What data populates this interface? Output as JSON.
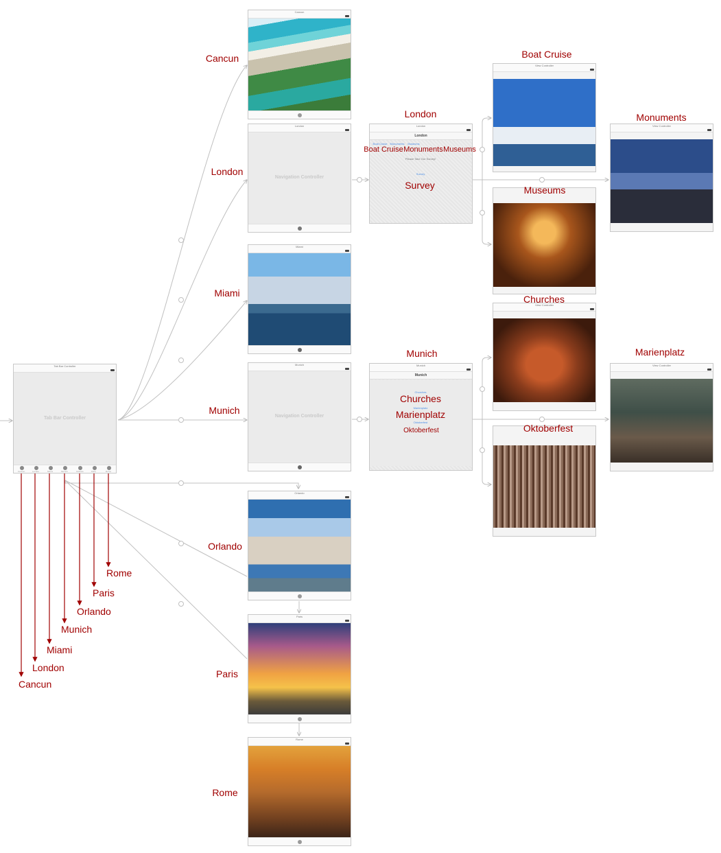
{
  "tab_bar_controller": {
    "title": "Tab Bar Controller",
    "placeholder": "Tab Bar Controller",
    "tab_items": [
      "Cancun",
      "London",
      "Miami",
      "Munich",
      "Orlando",
      "Paris",
      "Rome"
    ]
  },
  "nav_controllers": {
    "london": {
      "title": "London",
      "placeholder": "Navigation Controller"
    },
    "munich": {
      "title": "Munich",
      "placeholder": "Navigation Controller"
    }
  },
  "scenes": {
    "cancun": {
      "label": "Cancun",
      "title": "Cancun"
    },
    "london": {
      "label": "London",
      "title": "London"
    },
    "miami": {
      "label": "Miami",
      "title": "Miami"
    },
    "munich": {
      "label": "Munich",
      "title": "Munich"
    },
    "orlando": {
      "label": "Orlando",
      "title": "Orlando"
    },
    "paris": {
      "label": "Paris",
      "title": "Paris"
    },
    "rome": {
      "label": "Rome",
      "title": "Rome"
    },
    "london_vc": {
      "label": "London",
      "title": "London",
      "navbar": "London"
    },
    "munich_vc": {
      "label": "Munich",
      "title": "Munich",
      "navbar": "Munich"
    },
    "boat_cruise": {
      "label": "Boat Cruise",
      "title": "View Controller"
    },
    "museums": {
      "label": "Museums"
    },
    "monuments": {
      "label": "Monuments",
      "title": "View Controller"
    },
    "churches": {
      "label": "Churches",
      "title": "View Controller"
    },
    "marienplatz": {
      "label": "Marienplatz",
      "title": "View Controller"
    },
    "oktoberfest": {
      "label": "Oktoberfest"
    }
  },
  "london_vc": {
    "buttons_small": [
      "Boat Cruise",
      "Monuments",
      "Museums"
    ],
    "buttons_large": [
      "Boat Cruise",
      "Monuments",
      "Museums"
    ],
    "hint": "Please Take Our Survey!",
    "survey_small": "Survey",
    "survey_large": "Survey"
  },
  "munich_vc": {
    "churches_large": "Churches",
    "churches_small": "Churches",
    "marienplatz_large": "Marienplatz",
    "marienplatz_small": "Marienplatz",
    "oktoberfest_large": "Oktoberfest",
    "oktoberfest_small": "Oktoberfest"
  },
  "tab_annotations": [
    "Cancun",
    "London",
    "Miami",
    "Munich",
    "Orlando",
    "Paris",
    "Rome"
  ],
  "colors": {
    "annotation": "#a00000",
    "segue": "#bdbdbd",
    "link": "#4a8ee8"
  }
}
